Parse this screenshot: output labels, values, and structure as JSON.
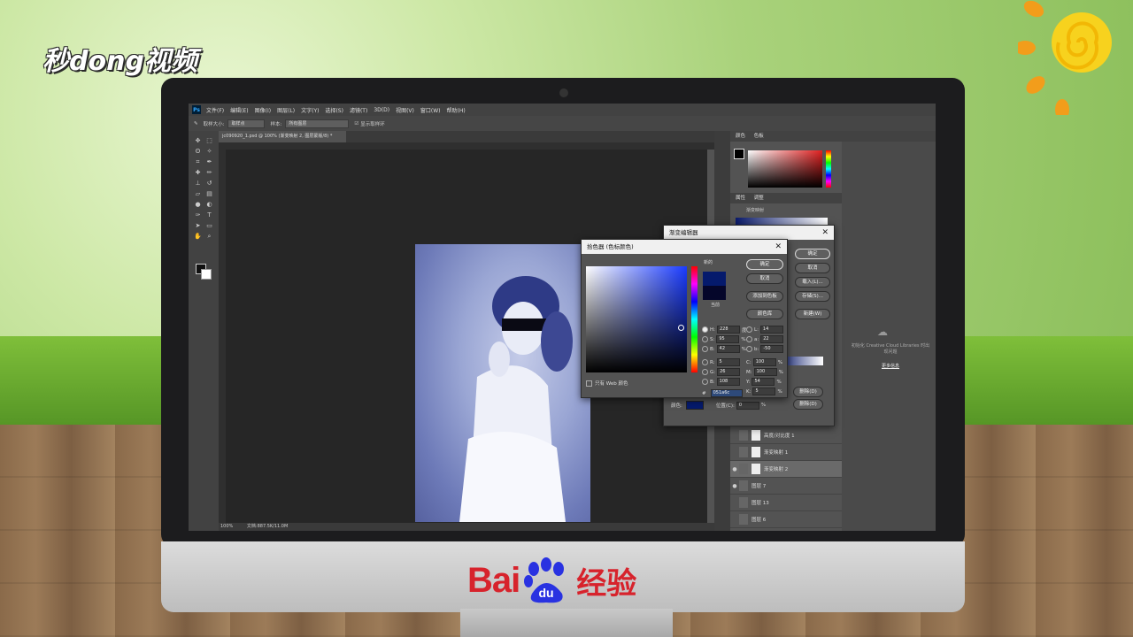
{
  "watermark": {
    "logo_text": "秒dong视频"
  },
  "brand": {
    "baidu_text": "Bai",
    "baidu_paw_text": "du",
    "baidu_suffix": "经验"
  },
  "colors": {
    "accent_red": "#d7232c",
    "picked_color": "#051a6c",
    "ps_bg": "#535353"
  },
  "photoshop": {
    "menu": [
      "文件(F)",
      "编辑(E)",
      "图像(I)",
      "图层(L)",
      "文字(Y)",
      "选择(S)",
      "滤镜(T)",
      "3D(D)",
      "视图(V)",
      "窗口(W)",
      "帮助(H)"
    ],
    "options": {
      "sample_size_label": "取样大小:",
      "sample_size_value": "取样点",
      "sample_label": "样本:",
      "sample_value": "所有图层",
      "show_ring_label": "显示取样环"
    },
    "doc_tab": "jc090920_1.psd @ 100% (渐变映射 2, 图层蒙版/8) *",
    "status": {
      "zoom": "100%",
      "doc_size": "文档:887.5K/11.0M"
    },
    "panels": {
      "color_tab": "颜色",
      "swatches_tab": "色板",
      "properties_tab": "属性",
      "adjustments_tab": "调整",
      "gradient_map_label": "渐变映射",
      "libraries_text": "初始化 Creative Cloud Libraries 时出现问题",
      "libraries_link": "更多信息"
    },
    "layers": [
      {
        "name": "高度/对比度 1"
      },
      {
        "name": "渐变映射 1"
      },
      {
        "name": "渐变映射 2"
      },
      {
        "name": "图层 7"
      },
      {
        "name": "图层 13"
      },
      {
        "name": "图层 6"
      }
    ]
  },
  "gradient_editor": {
    "title": "渐变编辑器",
    "ok": "确定",
    "cancel": "取消",
    "load": "载入(L)...",
    "save": "存储(S)...",
    "new": "新建(W)",
    "color_label": "颜色:",
    "position_label": "位置(C):",
    "position_value": "0",
    "percent": "%",
    "delete_top": "删除(D)",
    "delete_bottom": "删除(D)"
  },
  "color_picker": {
    "title": "拾色器 (色标颜色)",
    "new_label": "新的",
    "current_label": "当前",
    "ok": "确定",
    "cancel": "取消",
    "add_swatch": "添加到色板",
    "color_libraries": "颜色库",
    "web_only": "只有 Web 颜色",
    "hsb": [
      {
        "label": "H:",
        "value": "228",
        "unit": "度"
      },
      {
        "label": "S:",
        "value": "95",
        "unit": "%"
      },
      {
        "label": "B:",
        "value": "42",
        "unit": "%"
      }
    ],
    "rgb": [
      {
        "label": "R:",
        "value": "5"
      },
      {
        "label": "G:",
        "value": "26"
      },
      {
        "label": "B:",
        "value": "108"
      }
    ],
    "lab": [
      {
        "label": "L:",
        "value": "14"
      },
      {
        "label": "a:",
        "value": "22"
      },
      {
        "label": "b:",
        "value": "-50"
      }
    ],
    "cmyk": [
      {
        "label": "C:",
        "value": "100",
        "unit": "%"
      },
      {
        "label": "M:",
        "value": "100",
        "unit": "%"
      },
      {
        "label": "Y:",
        "value": "54",
        "unit": "%"
      },
      {
        "label": "K:",
        "value": "5",
        "unit": "%"
      }
    ],
    "hex_label": "#",
    "hex_value": "051a6c"
  }
}
